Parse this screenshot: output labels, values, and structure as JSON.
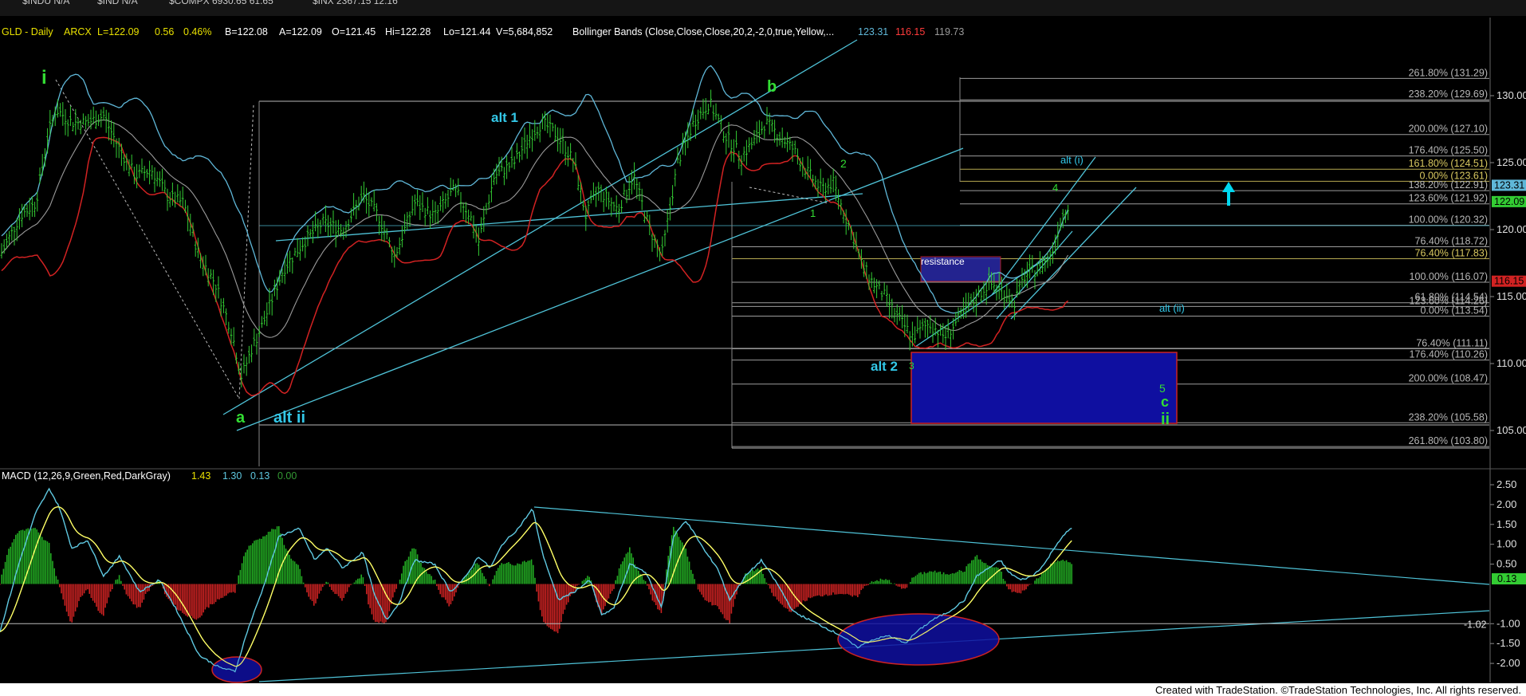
{
  "top_bar": {
    "items": [
      "$INDU N/A",
      "$IND N/A",
      "$COMPX 6930.65 61.65",
      "$INX 2367.15 12.16"
    ]
  },
  "header": {
    "symbol": "GLD - Daily",
    "exchange": "ARCX",
    "last": "L=122.09",
    "change": "0.56",
    "pct": "0.46%",
    "bid": "B=122.08",
    "ask": "A=122.09",
    "open": "O=121.45",
    "high": "Hi=122.28",
    "low": "Lo=121.44",
    "volume": "V=5,684,852",
    "study": "Bollinger Bands (Close,Close,Close,20,2,-2,0,true,Yellow,...",
    "bb_upper": "123.31",
    "bb_lower": "116.15",
    "bb_mid": "119.73"
  },
  "macd_header": {
    "study": "MACD (12,26,9,Green,Red,DarkGray)",
    "macd": "1.43",
    "signal": "1.30",
    "hist": "0.13",
    "zero": "0.00"
  },
  "footer": "Created with TradeStation. ©TradeStation Technologies, Inc. All rights reserved.",
  "colors": {
    "bg": "#000000",
    "price_bar": "#33cc33",
    "bb_upper": "#5fb7d8",
    "bb_mid": "#9a9a9a",
    "bb_lower": "#d22222",
    "trendline": "#4fc3d8",
    "fib": "#c8c8c8",
    "box": "#0f0fa0",
    "label_green": "#33dd33",
    "label_cyan": "#33c8e8",
    "macd_line": "#5fc8e0",
    "signal_line": "#ffff66",
    "hist_pos": "#22aa22",
    "hist_neg": "#cc2222"
  },
  "chart_data": [
    {
      "type": "candlestick",
      "symbol": "GLD",
      "interval": "Daily",
      "y_axis": {
        "ticks": [
          105,
          110,
          115,
          120,
          125,
          130
        ],
        "range": [
          102.5,
          132.5
        ]
      },
      "price_markers": [
        {
          "label": "123.31",
          "value": 123.31,
          "color": "#5fb7d8"
        },
        {
          "label": "122.09",
          "value": 122.09,
          "color": "#33cc33"
        },
        {
          "label": "116.15",
          "value": 116.15,
          "color": "#d22222"
        }
      ],
      "fib_levels": [
        {
          "label": "261.80% (131.29)",
          "value": 131.29
        },
        {
          "label": "238.20% (129.69)",
          "value": 129.69
        },
        {
          "label": "200.00% (127.10)",
          "value": 127.1
        },
        {
          "label": "176.40% (125.50)",
          "value": 125.5
        },
        {
          "label": "161.80% (124.51)",
          "value": 124.51
        },
        {
          "label": "0.00% (123.61)",
          "value": 123.61
        },
        {
          "label": "138.20% (122.91)",
          "value": 122.91
        },
        {
          "label": "123.60% (121.92)",
          "value": 121.92
        },
        {
          "label": "100.00% (120.32)",
          "value": 120.32
        },
        {
          "label": "76.40% (118.72)",
          "value": 118.72
        },
        {
          "label": "76.40% (117.83)",
          "value": 117.83
        },
        {
          "label": "100.00% (116.07)",
          "value": 116.07
        },
        {
          "label": "61.80% (114.54)",
          "value": 114.54
        },
        {
          "label": "123.60% (114.26)",
          "value": 114.26
        },
        {
          "label": "0.00% (113.54)",
          "value": 113.54
        },
        {
          "label": "76.40% (111.11)",
          "value": 111.11
        },
        {
          "label": "176.40% (110.26)",
          "value": 110.26
        },
        {
          "label": "200.00% (108.47)",
          "value": 108.47
        },
        {
          "label": "238.20% (105.58)",
          "value": 105.58
        },
        {
          "label": "261.80% (103.80)",
          "value": 103.8
        }
      ],
      "wave_labels": [
        {
          "text": "i",
          "color": "green"
        },
        {
          "text": "a",
          "color": "green"
        },
        {
          "text": "alt ii",
          "color": "cyan"
        },
        {
          "text": "alt 1",
          "color": "cyan"
        },
        {
          "text": "b",
          "color": "green"
        },
        {
          "text": "1",
          "color": "green"
        },
        {
          "text": "2",
          "color": "green"
        },
        {
          "text": "alt 2",
          "color": "cyan"
        },
        {
          "text": "3",
          "color": "green"
        },
        {
          "text": "4",
          "color": "green"
        },
        {
          "text": "5",
          "color": "green"
        },
        {
          "text": "c",
          "color": "green"
        },
        {
          "text": "ii",
          "color": "green"
        },
        {
          "text": "alt (i)",
          "color": "cyan"
        },
        {
          "text": "alt (ii)",
          "color": "cyan"
        },
        {
          "text": "resistance",
          "color": "white"
        }
      ]
    },
    {
      "type": "macd",
      "params": "12,26,9",
      "y_axis": {
        "ticks": [
          2.5,
          2.0,
          1.5,
          1.0,
          0.5,
          -1.0,
          -1.5,
          -2.0
        ],
        "tick_labels": [
          "2.50",
          "2.00",
          "1.50",
          "1.00",
          "0.50",
          "-1.00",
          "-1.50",
          "-2.00"
        ],
        "range": [
          -2.5,
          2.75
        ]
      },
      "markers": [
        {
          "label": "0.13",
          "value": 0.13
        },
        {
          "label": "-1.02",
          "value": -1.02
        }
      ]
    }
  ]
}
